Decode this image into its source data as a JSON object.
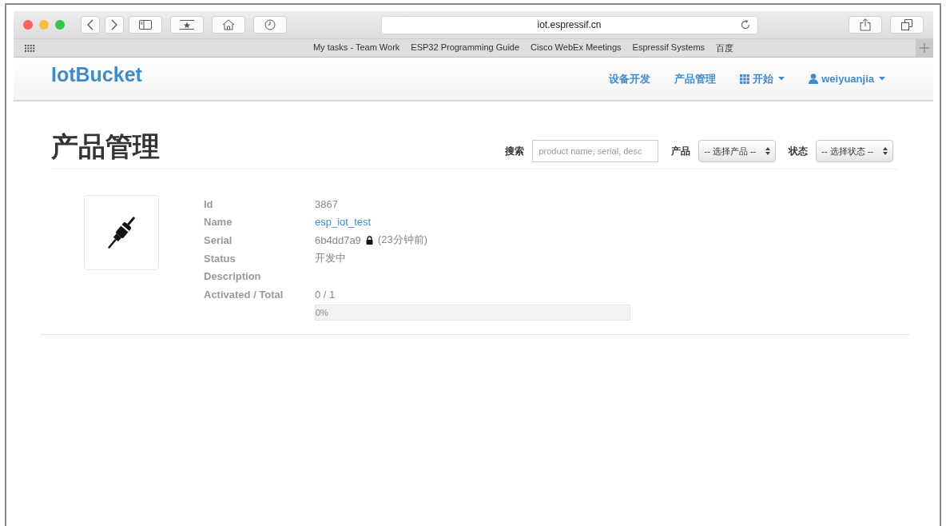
{
  "browser": {
    "url": "iot.espressif.cn",
    "bookmarks": [
      "My tasks - Team Work",
      "ESP32 Programming Guide",
      "Cisco WebEx Meetings",
      "Espressif Systems",
      "百度"
    ]
  },
  "navbar": {
    "brand": "IotBucket",
    "items": [
      {
        "label": "设备开发",
        "kind": "link"
      },
      {
        "label": "产品管理",
        "kind": "link"
      },
      {
        "label": "开始",
        "kind": "apps"
      },
      {
        "label": "weiyuanjia",
        "kind": "user"
      }
    ]
  },
  "page": {
    "title": "产品管理",
    "search_label": "搜索",
    "search_placeholder": "product name, serial, desc",
    "product_label": "产品",
    "product_select": "-- 选择产品 --",
    "status_label": "状态",
    "status_select": "-- 选择状态 --"
  },
  "product": {
    "fields": [
      {
        "label": "Id",
        "value": "3867",
        "kind": "text"
      },
      {
        "label": "Name",
        "value": "esp_iot_test",
        "kind": "link"
      },
      {
        "label": "Serial",
        "value": "6b4dd7a9",
        "note": "(23分钟前)",
        "kind": "locked"
      },
      {
        "label": "Status",
        "value": "开发中",
        "kind": "text"
      },
      {
        "label": "Description",
        "kind": "text"
      },
      {
        "label": "Activated / Total",
        "value": "0 / 1",
        "kind": "text"
      }
    ],
    "progress": {
      "reading": "0%"
    }
  }
}
